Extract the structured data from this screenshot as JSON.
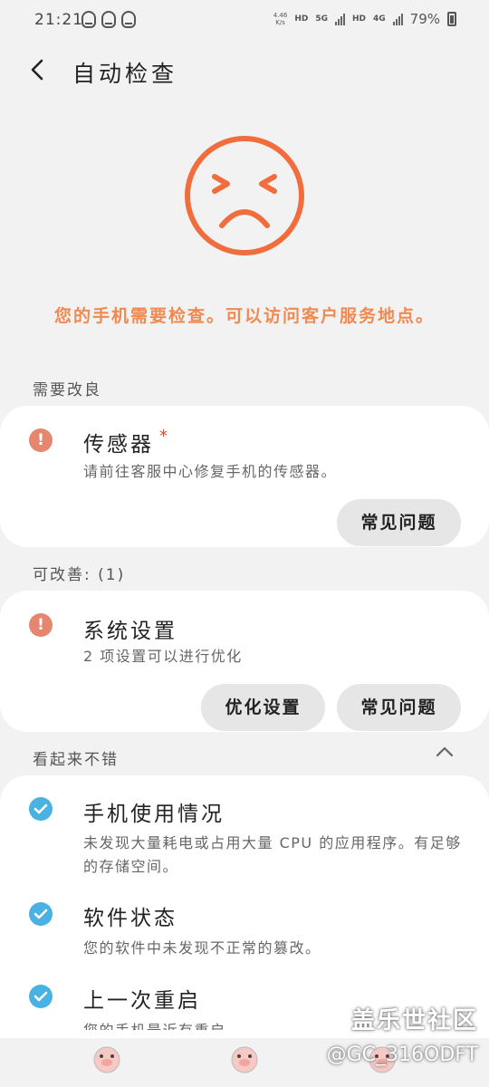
{
  "status_bar": {
    "time": "21:21",
    "net_speed_value": "4.46",
    "net_speed_unit": "K/s",
    "hd1": "HD",
    "net_5g": "5G",
    "hd2": "HD",
    "net_4g": "4G",
    "battery_percent": "79%"
  },
  "header": {
    "title": "自动检查"
  },
  "result": {
    "warning": "您的手机需要检查。可以访问客户服务地点。",
    "face_color": "#f26d3d"
  },
  "needs_repair": {
    "section_label": "需要改良",
    "items": [
      {
        "icon": "exclamation-icon",
        "title": "传感器",
        "star": "*",
        "description": "请前往客服中心修复手机的传感器。",
        "faq_label": "常见问题"
      }
    ]
  },
  "improvable": {
    "section_label": "可改善: (1)",
    "items": [
      {
        "icon": "exclamation-icon",
        "title": "系统设置",
        "description": "2 项设置可以进行优化",
        "optimize_label": "优化设置",
        "faq_label": "常见问题"
      }
    ]
  },
  "looks_good": {
    "section_label": "看起来不错",
    "items": [
      {
        "icon": "check-icon",
        "title": "手机使用情况",
        "description": "未发现大量耗电或占用大量 CPU 的应用程序。有足够的存储空间。"
      },
      {
        "icon": "check-icon",
        "title": "软件状态",
        "description": "您的软件中未发现不正常的篡改。"
      },
      {
        "icon": "check-icon",
        "title": "上一次重启",
        "description": "您的手机最近有重启"
      }
    ]
  },
  "watermark": {
    "site": "盖乐世社区",
    "user": "@GC_316ODFT"
  },
  "colors": {
    "accent_orange": "#f08a52",
    "alert_red": "#e5866e",
    "check_blue": "#4ab2e3"
  }
}
